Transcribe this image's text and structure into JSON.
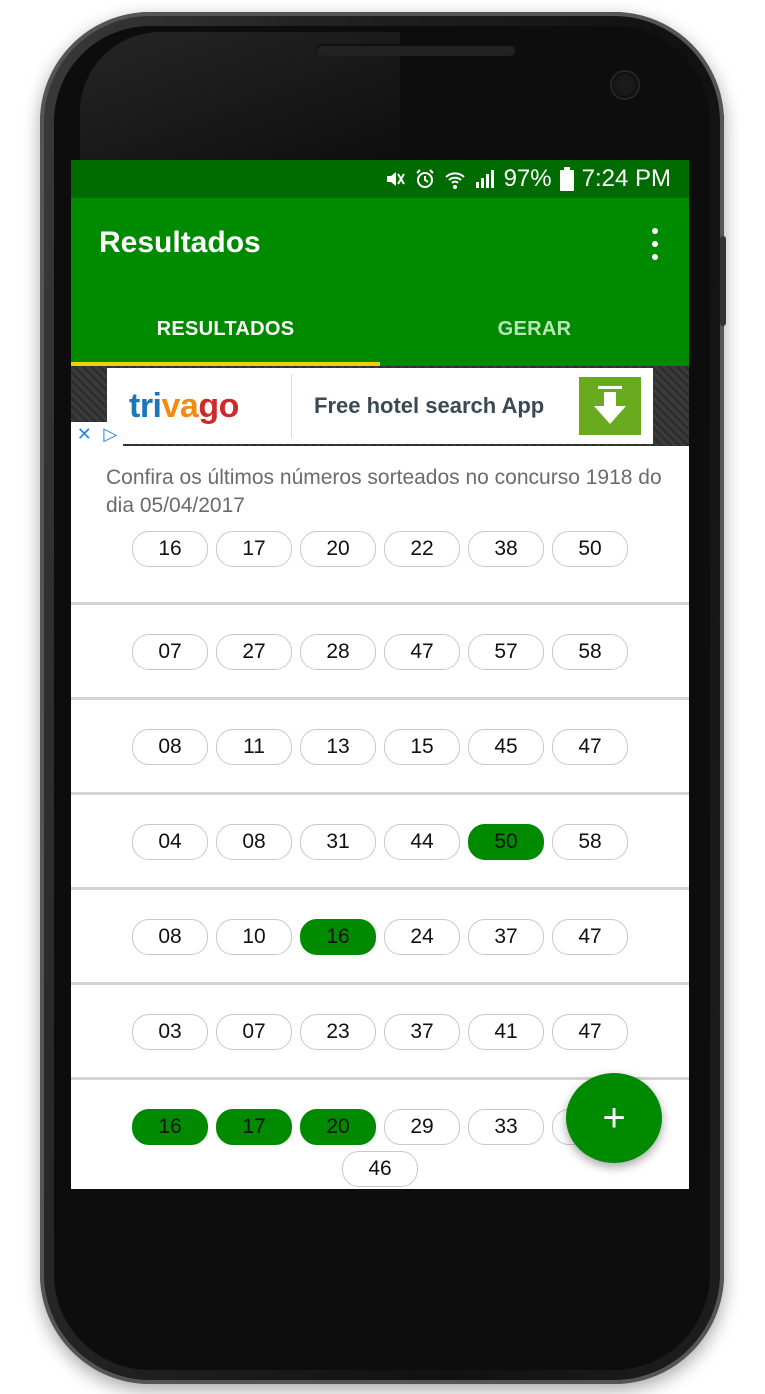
{
  "status_bar": {
    "battery": "97%",
    "time": "7:24 PM",
    "icons": [
      "mute-icon",
      "alarm-icon",
      "wifi-icon",
      "signal-icon",
      "battery-icon"
    ]
  },
  "app_bar": {
    "title": "Resultados",
    "menu_icon": "more-vert-icon"
  },
  "tabs": [
    {
      "label": "RESULTADOS",
      "selected": true
    },
    {
      "label": "GERAR",
      "selected": false
    }
  ],
  "ad": {
    "brand": {
      "part1": "tri",
      "part2": "va",
      "part3": "go"
    },
    "text": "Free hotel search App",
    "icons": [
      "download-icon",
      "close-icon",
      "adchoices-icon"
    ]
  },
  "intro_text": "Confira os últimos números sorteados no concurso 1918 do dia 05/04/2017",
  "drawn_numbers": [
    "16",
    "17",
    "20",
    "22",
    "38",
    "50"
  ],
  "games": [
    {
      "numbers": [
        "07",
        "27",
        "28",
        "47",
        "57",
        "58"
      ],
      "hits": []
    },
    {
      "numbers": [
        "08",
        "11",
        "13",
        "15",
        "45",
        "47"
      ],
      "hits": []
    },
    {
      "numbers": [
        "04",
        "08",
        "31",
        "44",
        "50",
        "58"
      ],
      "hits": [
        4
      ]
    },
    {
      "numbers": [
        "08",
        "10",
        "16",
        "24",
        "37",
        "47"
      ],
      "hits": [
        2
      ]
    },
    {
      "numbers": [
        "03",
        "07",
        "23",
        "37",
        "41",
        "47"
      ],
      "hits": []
    },
    {
      "numbers": [
        "16",
        "17",
        "20",
        "29",
        "33",
        "",
        "46"
      ],
      "hits": [
        0,
        1,
        2
      ]
    }
  ],
  "fab": {
    "label": "+"
  },
  "colors": {
    "primary": "#008a00",
    "primary_dark": "#006b00",
    "tab_indicator": "#f2d000",
    "hit": "#008a00"
  }
}
